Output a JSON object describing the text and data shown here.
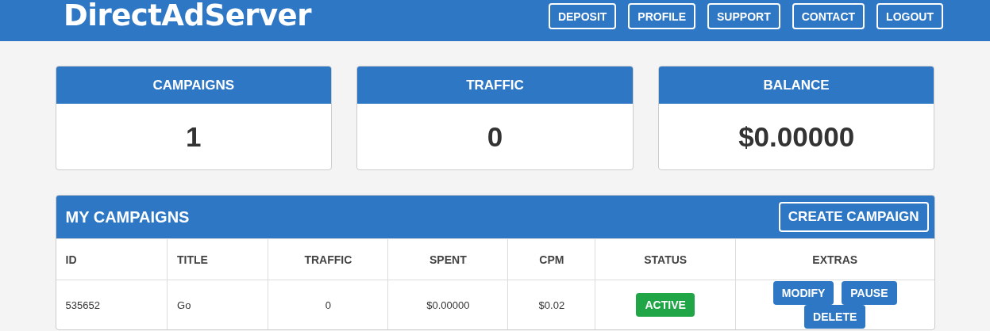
{
  "brand": "DirectAdServer",
  "nav": [
    "DEPOSIT",
    "PROFILE",
    "SUPPORT",
    "CONTACT",
    "LOGOUT"
  ],
  "stats": [
    {
      "label": "CAMPAIGNS",
      "value": "1"
    },
    {
      "label": "TRAFFIC",
      "value": "0"
    },
    {
      "label": "BALANCE",
      "value": "$0.00000"
    }
  ],
  "campaigns": {
    "title": "MY CAMPAIGNS",
    "create_button": "CREATE CAMPAIGN",
    "columns": [
      "ID",
      "TITLE",
      "TRAFFIC",
      "SPENT",
      "CPM",
      "STATUS",
      "EXTRAS"
    ],
    "rows": [
      {
        "id": "535652",
        "title": "Go",
        "traffic": "0",
        "spent": "$0.00000",
        "cpm": "$0.02",
        "status": {
          "label": "ACTIVE",
          "kind": "active"
        },
        "actions": [
          "MODIFY",
          "PAUSE",
          "DELETE"
        ]
      }
    ]
  }
}
